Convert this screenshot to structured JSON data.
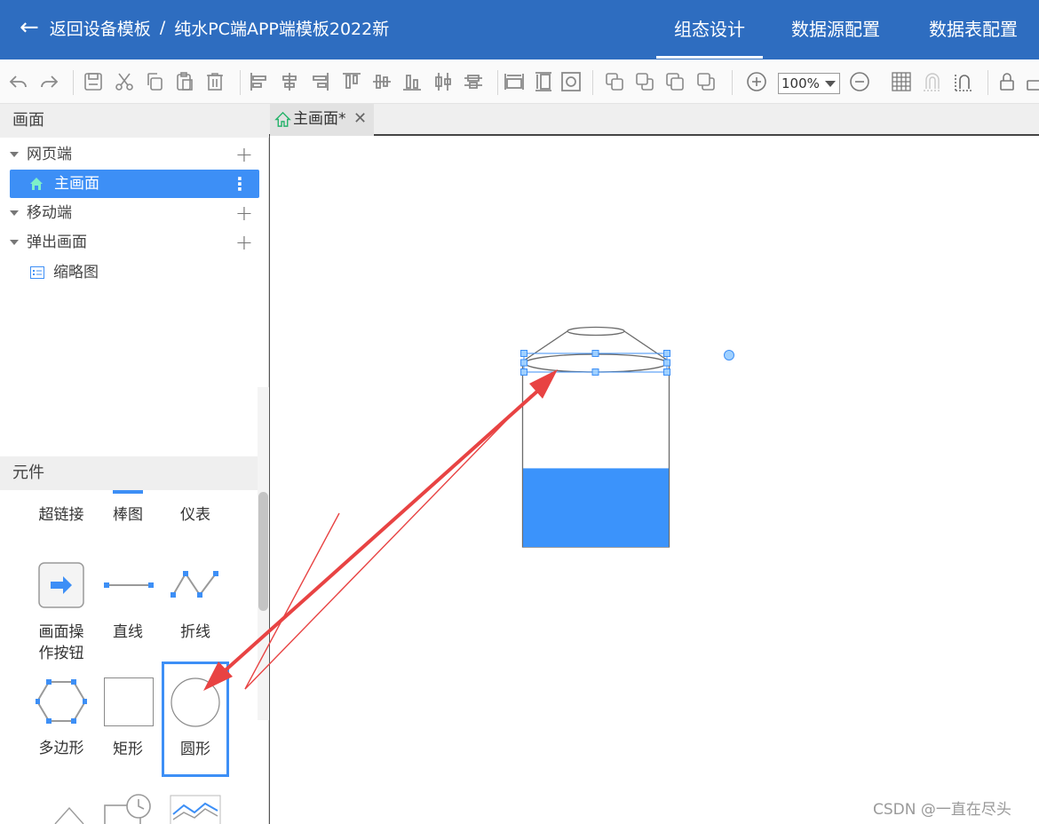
{
  "header": {
    "back_label": "返回设备模板",
    "separator": "/",
    "template_name": "纯水PC端APP端模板2022新",
    "tabs": [
      {
        "label": "组态设计",
        "active": true
      },
      {
        "label": "数据源配置",
        "active": false
      },
      {
        "label": "数据表配置",
        "active": false
      }
    ],
    "bg_color": "#2e6dc0"
  },
  "toolbar": {
    "icons": [
      "undo-icon",
      "redo-icon",
      "save-icon",
      "cut-icon",
      "copy-icon",
      "paste-icon",
      "delete-icon",
      "align-left-icon",
      "align-center-icon",
      "align-right-icon",
      "align-top-icon",
      "align-middle-icon",
      "align-bottom-icon",
      "distribute-horizontal-icon",
      "distribute-vertical-icon",
      "same-width-icon",
      "same-height-icon",
      "same-size-icon",
      "bring-front-icon",
      "send-back-icon",
      "bring-forward-icon",
      "send-backward-icon",
      "zoom-in-icon",
      "zoom-out-icon",
      "grid-icon",
      "snap-icon",
      "magnet-icon",
      "lock-icon"
    ],
    "zoom_value": "100%"
  },
  "left_panel": {
    "screens_title": "画面",
    "tree": {
      "web": "网页端",
      "main_screen": "主画面",
      "mobile": "移动端",
      "popup": "弹出画面",
      "thumbnail": "缩略图"
    },
    "components_title": "元件",
    "widgets": {
      "hyperlink": "超链接",
      "bar_chart": "棒图",
      "gauge": "仪表",
      "screen_button": "画面操\n作按钮",
      "line": "直线",
      "polyline": "折线",
      "polygon": "多边形",
      "rectangle": "矩形",
      "circle": "圆形"
    },
    "accent_color": "#3d8ff6"
  },
  "canvas": {
    "tab_label": "主画面*",
    "tank_fill_fraction": 0.43,
    "fill_color": "#3b93fb"
  },
  "watermark": "CSDN @一直在尽头"
}
